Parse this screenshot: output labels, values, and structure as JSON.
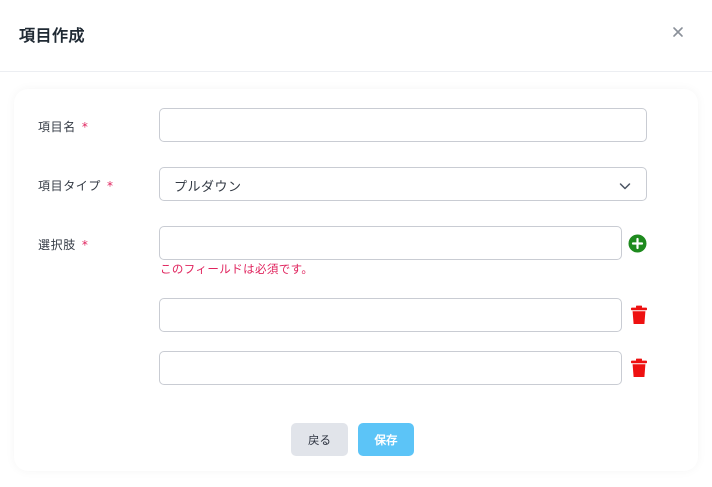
{
  "modal": {
    "title": "項目作成",
    "close_icon": "close-icon"
  },
  "form": {
    "name_field": {
      "label": "項目名",
      "required_mark": "*",
      "value": ""
    },
    "type_field": {
      "label": "項目タイプ",
      "required_mark": "*",
      "selected": "プルダウン",
      "icon": "chevron-down-icon"
    },
    "choices_field": {
      "label": "選択肢",
      "required_mark": "*",
      "error": "このフィールドは必須です。",
      "options": [
        {
          "value": "",
          "action_icon": "plus-circle-icon"
        },
        {
          "value": "",
          "action_icon": "trash-icon"
        },
        {
          "value": "",
          "action_icon": "trash-icon"
        }
      ]
    }
  },
  "footer": {
    "back_label": "戻る",
    "save_label": "保存"
  },
  "colors": {
    "required": "#e0245e",
    "add_icon": "#1e8a1e",
    "delete_icon": "#ee1111",
    "save_button": "#5cc4f7",
    "back_button": "#e1e4ea"
  }
}
